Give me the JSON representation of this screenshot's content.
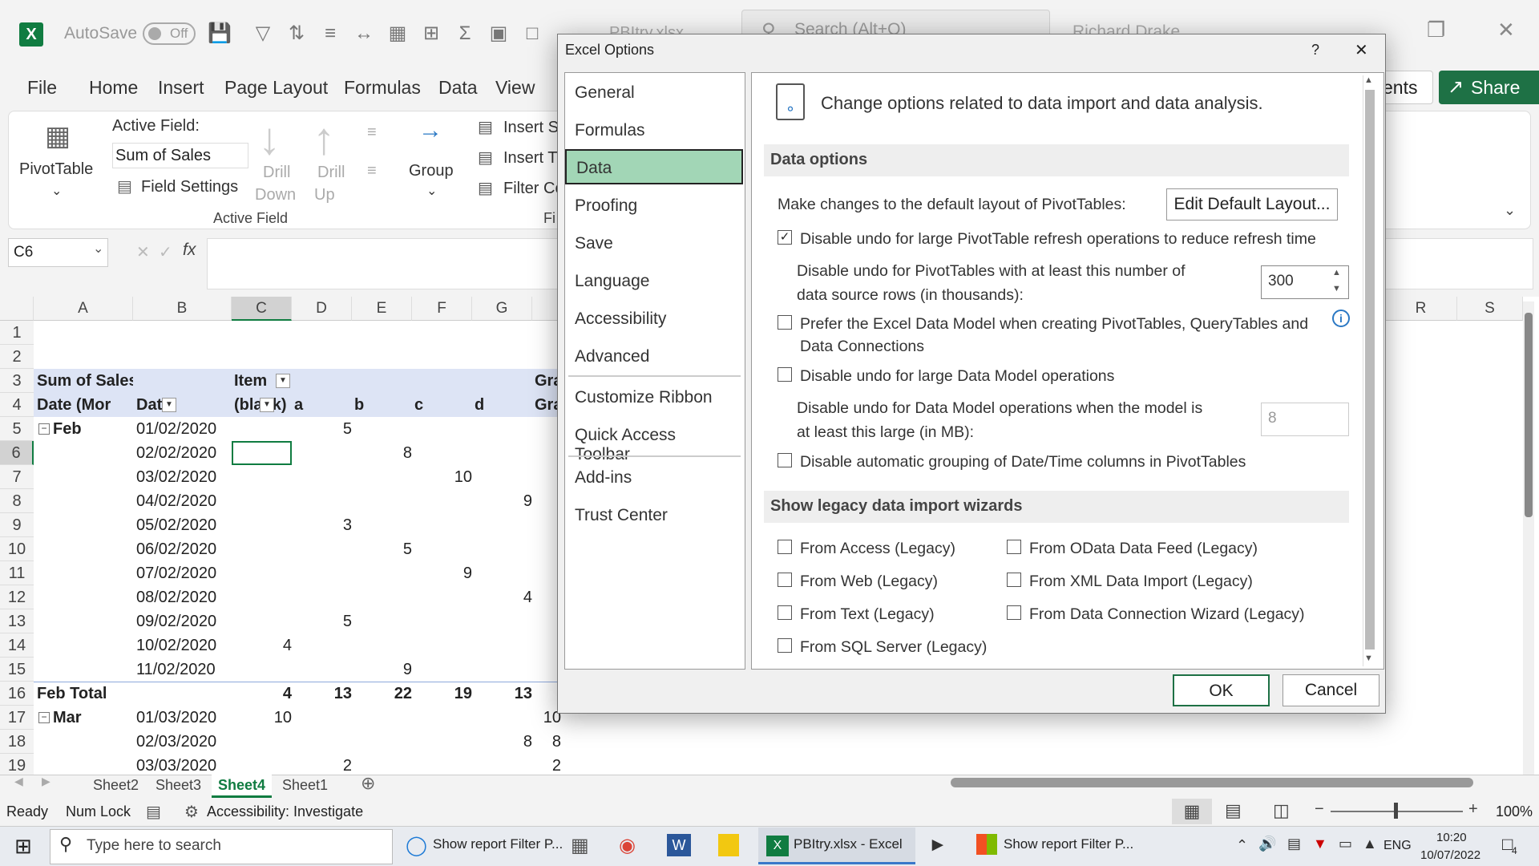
{
  "window": {
    "autosave_label": "AutoSave",
    "autosave_state": "Off",
    "filename": "PBItry.xlsx",
    "search_placeholder": "Search (Alt+Q)",
    "user_name": "Richard Drake"
  },
  "menu": {
    "items": [
      "File",
      "Home",
      "Insert",
      "Page Layout",
      "Formulas",
      "Data",
      "View"
    ],
    "comments_label": "ents",
    "share_label": "Share"
  },
  "ribbon": {
    "pivottable_label": "PivotTable",
    "active_field_label": "Active Field:",
    "active_field_value": "Sum of Sales",
    "field_settings_label": "Field Settings",
    "drill_down_1": "Drill",
    "drill_down_2": "Down",
    "drill_up_1": "Drill",
    "drill_up_2": "Up",
    "group_active_field": "Active Field",
    "group_label": "Group",
    "insert_slicer": "Insert S",
    "insert_timeline": "Insert T",
    "filter_connections": "Filter Co",
    "group_fi": "Fi"
  },
  "formula_bar": {
    "name_box": "C6",
    "fx": "fx"
  },
  "sheet": {
    "columns": [
      "A",
      "B",
      "C",
      "D",
      "E",
      "F",
      "G",
      "R",
      "S"
    ],
    "rows": [
      "1",
      "2",
      "3",
      "4",
      "5",
      "6",
      "7",
      "8",
      "9",
      "10",
      "11",
      "12",
      "13",
      "14",
      "15",
      "16",
      "17",
      "18",
      "19"
    ],
    "pivot_header_1": [
      "Sum of Sales",
      "",
      "Item",
      "",
      "",
      "",
      "",
      "Gra"
    ],
    "pivot_header_2": [
      "Date (Mor",
      "Date",
      "(blank)",
      "a",
      "b",
      "c",
      "d",
      "Gra"
    ],
    "data_rows": [
      [
        "Feb",
        "01/02/2020",
        "",
        "5",
        "",
        "",
        "",
        ""
      ],
      [
        "",
        "02/02/2020",
        "",
        "",
        "8",
        "",
        "",
        ""
      ],
      [
        "",
        "03/02/2020",
        "",
        "",
        "",
        "10",
        "",
        ""
      ],
      [
        "",
        "04/02/2020",
        "",
        "",
        "",
        "",
        "9",
        ""
      ],
      [
        "",
        "05/02/2020",
        "",
        "3",
        "",
        "",
        "",
        ""
      ],
      [
        "",
        "06/02/2020",
        "",
        "",
        "5",
        "",
        "",
        ""
      ],
      [
        "",
        "07/02/2020",
        "",
        "",
        "",
        "9",
        "",
        ""
      ],
      [
        "",
        "08/02/2020",
        "",
        "",
        "",
        "",
        "4",
        ""
      ],
      [
        "",
        "09/02/2020",
        "",
        "5",
        "",
        "",
        "",
        ""
      ],
      [
        "",
        "10/02/2020",
        "4",
        "",
        "",
        "",
        "",
        ""
      ],
      [
        "",
        "11/02/2020",
        "",
        "",
        "9",
        "",
        "",
        ""
      ],
      [
        "Feb Total",
        "",
        "4",
        "13",
        "22",
        "19",
        "13",
        ""
      ],
      [
        "Mar",
        "01/03/2020",
        "10",
        "",
        "",
        "",
        "",
        "10"
      ],
      [
        "",
        "02/03/2020",
        "",
        "",
        "",
        "",
        "8",
        "8"
      ],
      [
        "",
        "03/03/2020",
        "",
        "2",
        "",
        "",
        "",
        "2"
      ]
    ],
    "tabs": [
      "Sheet2",
      "Sheet3",
      "Sheet4",
      "Sheet1"
    ],
    "active_tab": "Sheet4"
  },
  "statusbar": {
    "ready": "Ready",
    "numlock": "Num Lock",
    "accessibility": "Accessibility: Investigate",
    "zoom": "100%"
  },
  "taskbar": {
    "search_placeholder": "Type here to search",
    "item1": "Show report Filter P...",
    "item2": "PBItry.xlsx - Excel",
    "item3": "Show report Filter P...",
    "lang": "ENG",
    "time": "10:20",
    "date": "10/07/2022",
    "notif_count": "4"
  },
  "dialog": {
    "title": "Excel Options",
    "help": "?",
    "close": "✕",
    "nav": [
      "General",
      "Formulas",
      "Data",
      "Proofing",
      "Save",
      "Language",
      "Accessibility",
      "Advanced",
      "Customize Ribbon",
      "Quick Access Toolbar",
      "Add-ins",
      "Trust Center"
    ],
    "selected": "Data",
    "heading": "Change options related to data import and data analysis.",
    "section_data_options": "Data options",
    "default_layout_text": "Make changes to the default layout of PivotTables:",
    "edit_default_layout": "Edit Default Layout...",
    "opt_disable_undo_refresh": "Disable undo for large PivotTable refresh operations to reduce refresh time",
    "opt_disable_undo_refresh_checked": true,
    "undo_rows_line1": "Disable undo for PivotTables with at least this number of",
    "undo_rows_line2": "data source rows (in thousands):",
    "undo_rows_value": "300",
    "opt_prefer_model_line1": "Prefer the Excel Data Model when creating PivotTables, QueryTables and",
    "opt_prefer_model_line2": "Data Connections",
    "opt_disable_undo_model": "Disable undo for large Data Model operations",
    "undo_model_line1": "Disable undo for Data Model operations when the model is",
    "undo_model_line2": "at least this large (in MB):",
    "undo_model_value": "8",
    "opt_disable_grouping": "Disable automatic grouping of Date/Time columns in PivotTables",
    "section_legacy": "Show legacy data import wizards",
    "legacy_left": [
      "From Access (Legacy)",
      "From Web (Legacy)",
      "From Text (Legacy)",
      "From SQL Server (Legacy)"
    ],
    "legacy_right": [
      "From OData Data Feed (Legacy)",
      "From XML Data Import (Legacy)",
      "From Data Connection Wizard (Legacy)"
    ],
    "ok": "OK",
    "cancel": "Cancel"
  },
  "colors": {
    "excel_green": "#107c41",
    "share_green": "#1e7145",
    "nav_selected": "#a2d6b6",
    "pivot_header": "#dde4f5"
  }
}
